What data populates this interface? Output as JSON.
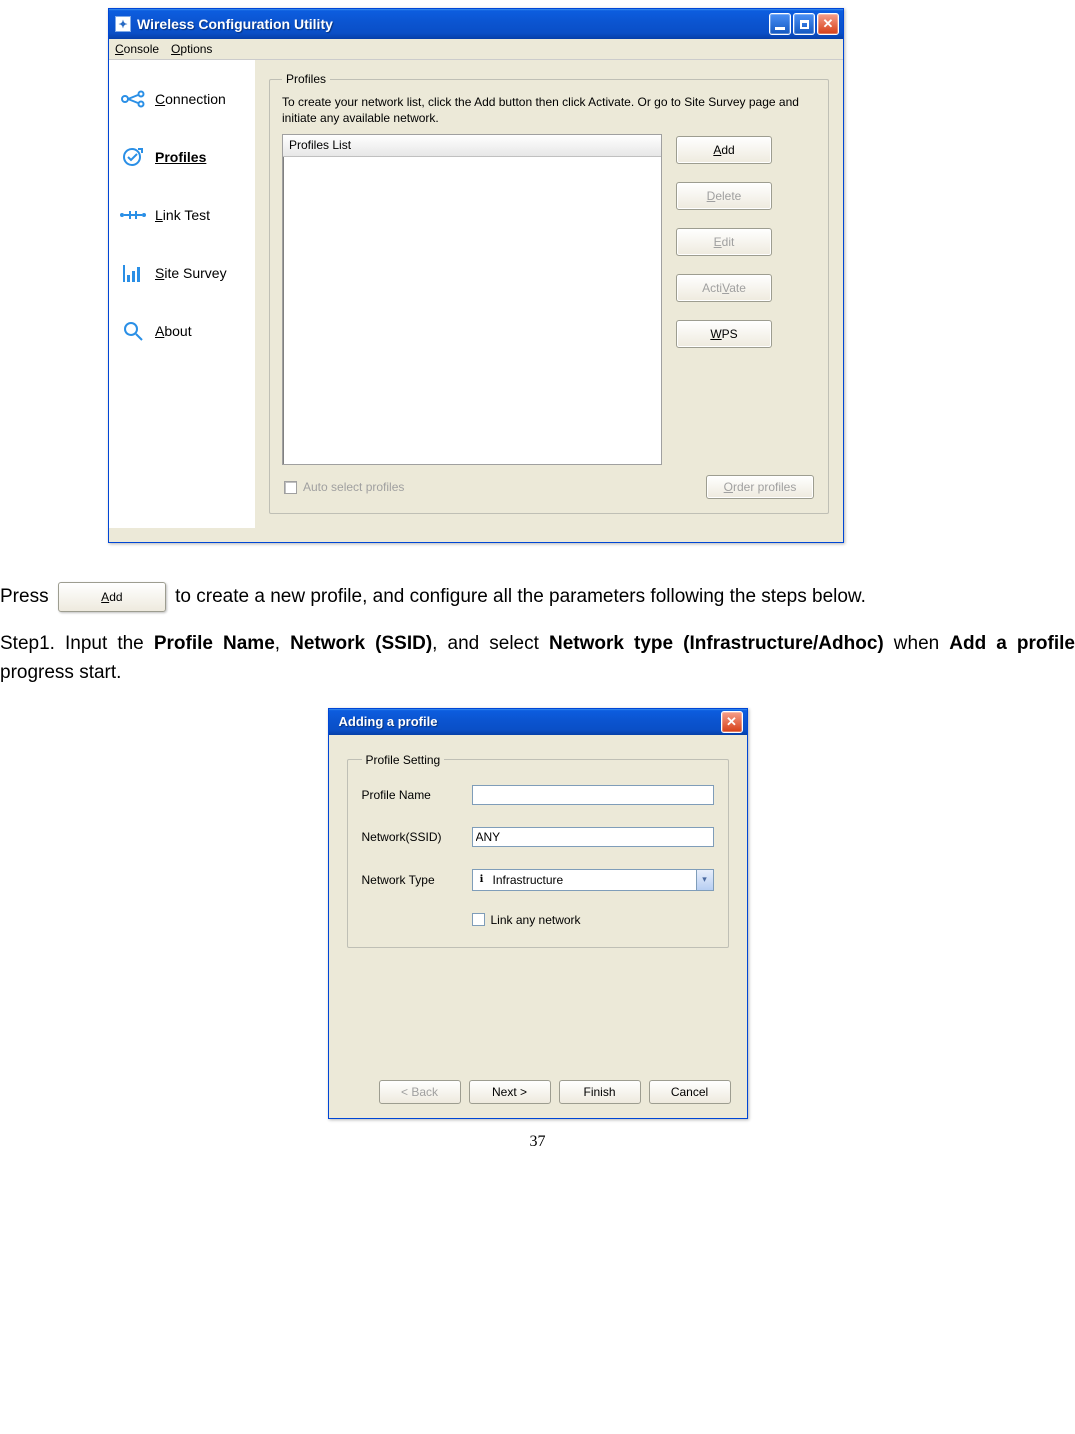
{
  "utility_window": {
    "title": "Wireless Configuration Utility",
    "menu": {
      "console": "Console",
      "options": "Options"
    },
    "sidebar": {
      "items": [
        {
          "label": "Connection"
        },
        {
          "label": "Profiles"
        },
        {
          "label": "Link Test"
        },
        {
          "label": "Site Survey"
        },
        {
          "label": "About"
        }
      ]
    },
    "profiles_group": {
      "legend": "Profiles",
      "hint": "To create your network list, click the Add button then click Activate. Or go to Site Survey page and initiate any available network.",
      "list_header": "Profiles List",
      "buttons": {
        "add": "Add",
        "delete": "Delete",
        "edit": "Edit",
        "activate": "ActiVate",
        "wps": "WPS"
      },
      "auto_select": "Auto select profiles",
      "order_profiles": "Order profiles"
    }
  },
  "doc": {
    "press": "Press ",
    "add_btn": "Add",
    "after_press": " to create a new profile, and configure all the parameters following the steps below.",
    "step1_a": "Step1.   Input   the   ",
    "step1_profile_name": "Profile   Name",
    "step1_comma1": ",   ",
    "step1_network_ssid": "Network   (SSID)",
    "step1_comma2": ",   and   select   ",
    "step1_network_type": "Network   type ",
    "step1_infra": "(Infrastructure/Adhoc)",
    "step1_when": " when ",
    "step1_addprofile": "Add a profile",
    "step1_end": " progress start.",
    "page_number": "37"
  },
  "dialog": {
    "title": "Adding a profile",
    "ps_legend": "Profile Setting",
    "labels": {
      "profile_name": "Profile Name",
      "network_ssid": "Network(SSID)",
      "network_type": "Network Type"
    },
    "values": {
      "profile_name": "",
      "network_ssid": "ANY",
      "network_type": "Infrastructure"
    },
    "link_any": "Link any network",
    "buttons": {
      "back": "< Back",
      "next": "Next >",
      "finish": "Finish",
      "cancel": "Cancel"
    }
  }
}
